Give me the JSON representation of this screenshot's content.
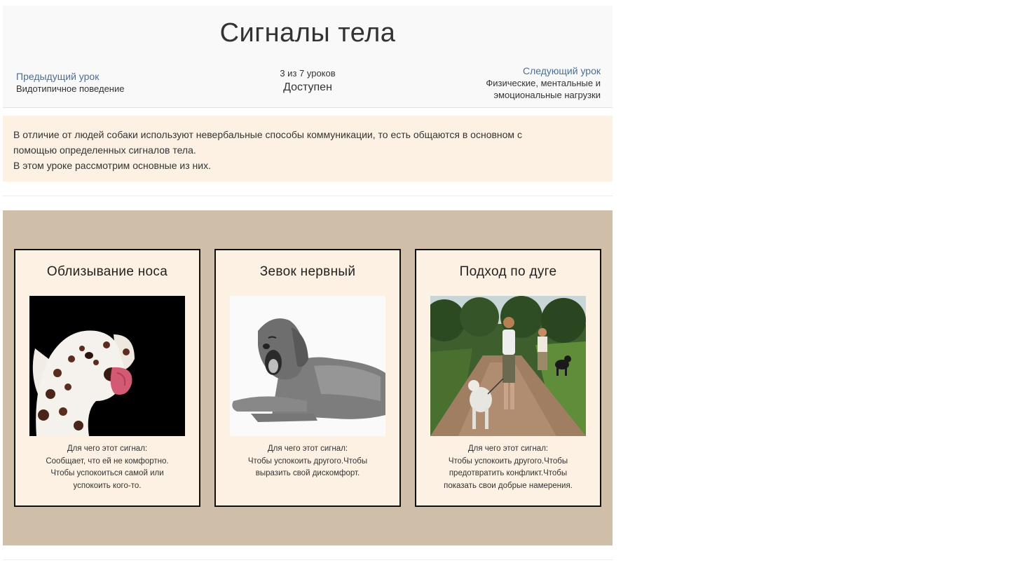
{
  "lesson": {
    "title": "Сигналы тела",
    "prev_label": "Предыдущий урок",
    "prev_title": "Видотипичное поведение",
    "count": "3 из 7 уроков",
    "status": "Доступен",
    "next_label": "Следующий урок",
    "next_title_line1": "Физические, ментальные и",
    "next_title_line2": "эмоциональные нагрузки"
  },
  "intro": {
    "line1": "В отличие от людей собаки используют невербальные способы коммуникации, то есть общаются в основном с",
    "line2": "помощью определенных сигналов тела.",
    "line3": "В этом уроке рассмотрим основные из них."
  },
  "cards": [
    {
      "title": "Облизывание носа",
      "image": "dalmatian-licking-nose",
      "lines": [
        "Для чего этот сигнал:",
        "Сообщает, что ей не комфортно.",
        "Чтобы успокоиться самой или",
        "успокоить кого-то."
      ]
    },
    {
      "title": "Зевок нервный",
      "image": "retriever-yawning",
      "lines": [
        "Для чего этот сигнал:",
        "Чтобы успокоить другого.Чтобы",
        "выразить свой дискомфорт."
      ]
    },
    {
      "title": "Подход по дуге",
      "image": "people-walking-dogs-on-path",
      "lines": [
        "Для чего этот сигнал:",
        "Чтобы успокоить другого.Чтобы",
        "предотвратить конфликт.Чтобы",
        "показать свои добрые намерения."
      ]
    }
  ],
  "colors": {
    "header_bg": "#f9f9f9",
    "intro_bg": "#fdf1e3",
    "section_bg": "#cfbfa9",
    "card_bg": "#fdf1e3",
    "link": "#4a6f93"
  }
}
